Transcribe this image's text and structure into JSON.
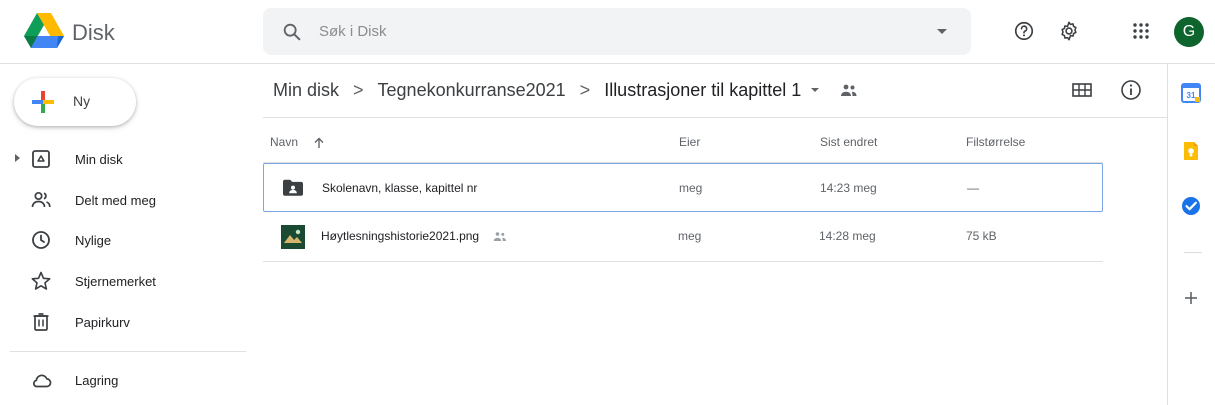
{
  "header": {
    "brand": "Disk",
    "search_placeholder": "Søk i Disk",
    "avatar_letter": "G",
    "icons": [
      "drive-logo-icon",
      "search-icon",
      "search-options-icon",
      "help-icon",
      "settings-icon",
      "apps-grid-icon"
    ]
  },
  "sidebar": {
    "new_label": "Ny",
    "items": [
      {
        "label": "Min disk",
        "icon": "my-drive-icon"
      },
      {
        "label": "Delt med meg",
        "icon": "shared-people-icon"
      },
      {
        "label": "Nylige",
        "icon": "clock-icon"
      },
      {
        "label": "Stjernemerket",
        "icon": "star-icon"
      },
      {
        "label": "Papirkurv",
        "icon": "trash-icon"
      },
      {
        "label": "Lagring",
        "icon": "cloud-icon"
      }
    ]
  },
  "breadcrumb": {
    "items": [
      "Min disk",
      "Tegnekonkurranse2021",
      "Illustrasjoner til kapittel 1"
    ],
    "separator": ">"
  },
  "file_list": {
    "columns": {
      "name": "Navn",
      "owner": "Eier",
      "modified": "Sist endret",
      "size": "Filstørrelse"
    },
    "rows": [
      {
        "name": "Skolenavn, klasse, kapittel nr",
        "owner": "meg",
        "modified": "14:23 meg",
        "size": "—",
        "type": "shared-folder",
        "selected": true
      },
      {
        "name": "Høytlesningshistorie2021.png",
        "owner": "meg",
        "modified": "14:28 meg",
        "size": "75 kB",
        "type": "image",
        "shared": true,
        "selected": false
      }
    ]
  },
  "colors": {
    "accent": "#1a73e8",
    "avatar_bg": "#0d652d",
    "selection_border": "#7aa5e8",
    "search_bg": "#f1f3f4"
  }
}
